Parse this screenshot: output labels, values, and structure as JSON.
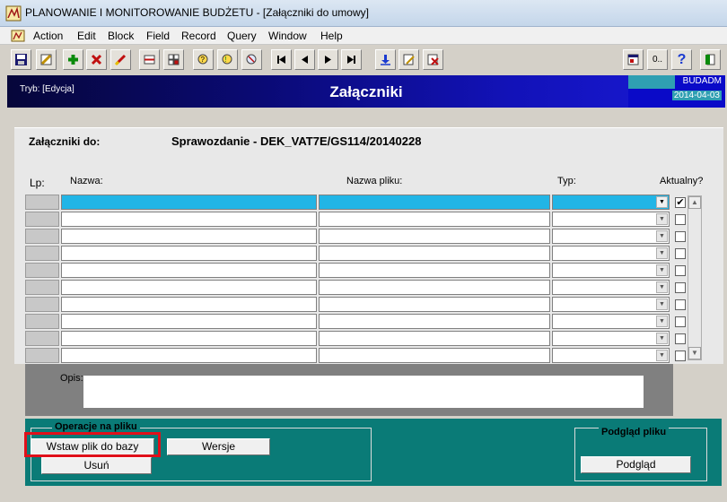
{
  "window": {
    "title": "PLANOWANIE I MONITOROWANIE BUDŻETU - [Załączniki do umowy]"
  },
  "menu": [
    "Action",
    "Edit",
    "Block",
    "Field",
    "Record",
    "Query",
    "Window",
    "Help"
  ],
  "toolbar": {
    "sound_label": "0..",
    "help_label": "?"
  },
  "header": {
    "mode": "Tryb: [Edycja]",
    "title": "Załączniki",
    "user": "BUDADM",
    "date": "2014-04-03"
  },
  "form": {
    "zalaczniki_label": "Załączniki do:",
    "zalaczniki_value": "Sprawozdanie - DEK_VAT7E/GS114/20140228",
    "columns": {
      "lp": "Lp:",
      "nazwa": "Nazwa:",
      "nazwa_pliku": "Nazwa pliku:",
      "typ": "Typ:",
      "aktualny": "Aktualny?"
    },
    "rows_count": 10,
    "selected_row": 0,
    "first_row_checked": true,
    "opis_label": "Opis:"
  },
  "operations": {
    "group_title": "Operacje na pliku",
    "insert_button": "Wstaw plik do bazy",
    "versions_button": "Wersje",
    "delete_button": "Usuń"
  },
  "preview": {
    "group_title": "Podgląd pliku",
    "preview_button": "Podgląd"
  }
}
